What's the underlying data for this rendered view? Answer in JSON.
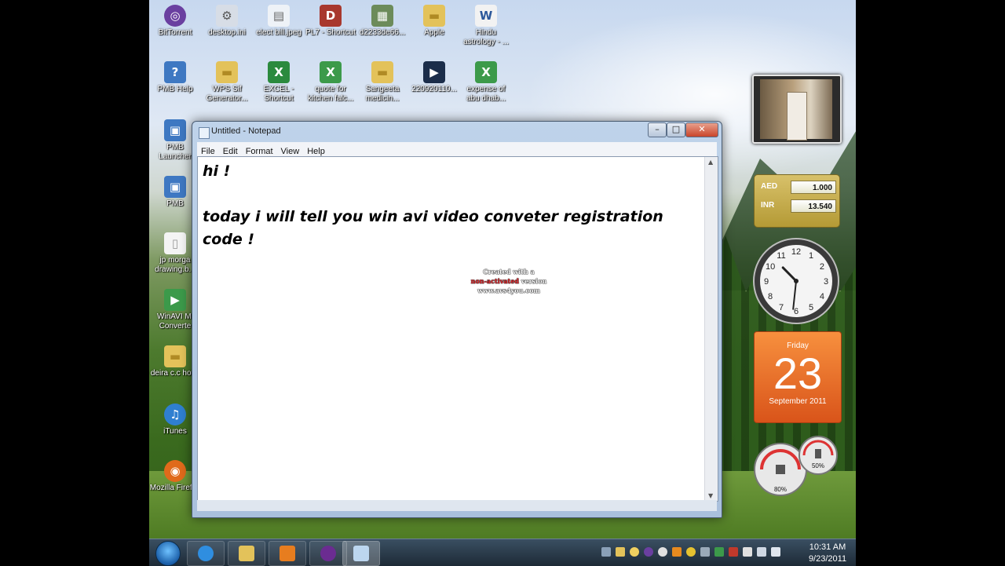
{
  "desktop": {
    "icons": [
      {
        "label": "BitTorrent",
        "color": "#6a3fa0",
        "glyph": "◎"
      },
      {
        "label": "desktop.ini",
        "color": "#d7dde6",
        "glyph": "⚙"
      },
      {
        "label": "elect bill.jpeg",
        "color": "#eef2f7",
        "glyph": "▤"
      },
      {
        "label": "PL7 - Shortcut",
        "color": "#a8382e",
        "glyph": "D"
      },
      {
        "label": "d2233de66...",
        "color": "#6c8b5a",
        "glyph": "▦"
      },
      {
        "label": "Apple",
        "color": "#e3c25a",
        "glyph": "▬"
      },
      {
        "label": "Hindu astrology - ...",
        "color": "#f2f2f2",
        "glyph": "W"
      },
      {
        "label": "PMB Help",
        "color": "#3e78c2",
        "glyph": "?"
      },
      {
        "label": "WPS Sif Generator...",
        "color": "#e3c25a",
        "glyph": "▬"
      },
      {
        "label": "EXCEL - Shortcut",
        "color": "#2b8a3e",
        "glyph": "X"
      },
      {
        "label": "quote for kitchen falc...",
        "color": "#3c9a4a",
        "glyph": "X"
      },
      {
        "label": "Sangeeta medicin...",
        "color": "#e3c25a",
        "glyph": "▬"
      },
      {
        "label": "220920110...",
        "color": "#1b2d4a",
        "glyph": "▶"
      },
      {
        "label": "expense of abu dhab...",
        "color": "#3c9a4a",
        "glyph": "X"
      },
      {
        "label": "PMB Launcher",
        "color": "#3e78c2",
        "glyph": "▣"
      },
      {
        "label": "PMB",
        "color": "#3e78c2",
        "glyph": "▣"
      },
      {
        "label": "jp morga drawing.b...",
        "color": "#f4f4f4",
        "glyph": "▯"
      },
      {
        "label": "WinAVI Mi Converte",
        "color": "#3c9a4a",
        "glyph": "▶"
      },
      {
        "label": "deira c.c hotel",
        "color": "#e3c25a",
        "glyph": "▬"
      },
      {
        "label": "iTunes",
        "color": "#2f7fd0",
        "glyph": "♫"
      },
      {
        "label": "Mozilla Firefox",
        "color": "#e06a1b",
        "glyph": "◉"
      }
    ]
  },
  "notepad": {
    "title": "Untitled - Notepad",
    "menu": [
      "File",
      "Edit",
      "Format",
      "View",
      "Help"
    ],
    "text_lines": [
      "hi !",
      "",
      "today i will tell you win avi video conveter registration",
      "code !"
    ],
    "watermark": [
      "Created with a",
      "non-activated",
      "version",
      "www.avs4you.com"
    ],
    "buttons": {
      "minimize": "–",
      "maximize": "□",
      "close": "✕"
    }
  },
  "gadgets": {
    "currency": [
      {
        "code": "AED",
        "value": "1.000"
      },
      {
        "code": "INR",
        "value": "13.540"
      }
    ],
    "clock": {
      "hour": 10,
      "minute": 31,
      "numbers": [
        "12",
        "1",
        "2",
        "3",
        "4",
        "5",
        "6",
        "7",
        "8",
        "9",
        "10",
        "11"
      ]
    },
    "calendar": {
      "day": "Friday",
      "date": "23",
      "month_year": "September 2011"
    },
    "meter": {
      "cpu": "80%",
      "memory": "50%"
    }
  },
  "taskbar": {
    "time": "10:31 AM",
    "date": "9/23/2011",
    "items": [
      {
        "name": "internet-explorer",
        "color": "#2f8ee0"
      },
      {
        "name": "windows-explorer",
        "color": "#e3c25a"
      },
      {
        "name": "media-player",
        "color": "#e77d1f"
      },
      {
        "name": "yahoo-messenger",
        "color": "#6b2c91"
      },
      {
        "name": "notepad",
        "color": "#bcd6ef"
      }
    ]
  }
}
